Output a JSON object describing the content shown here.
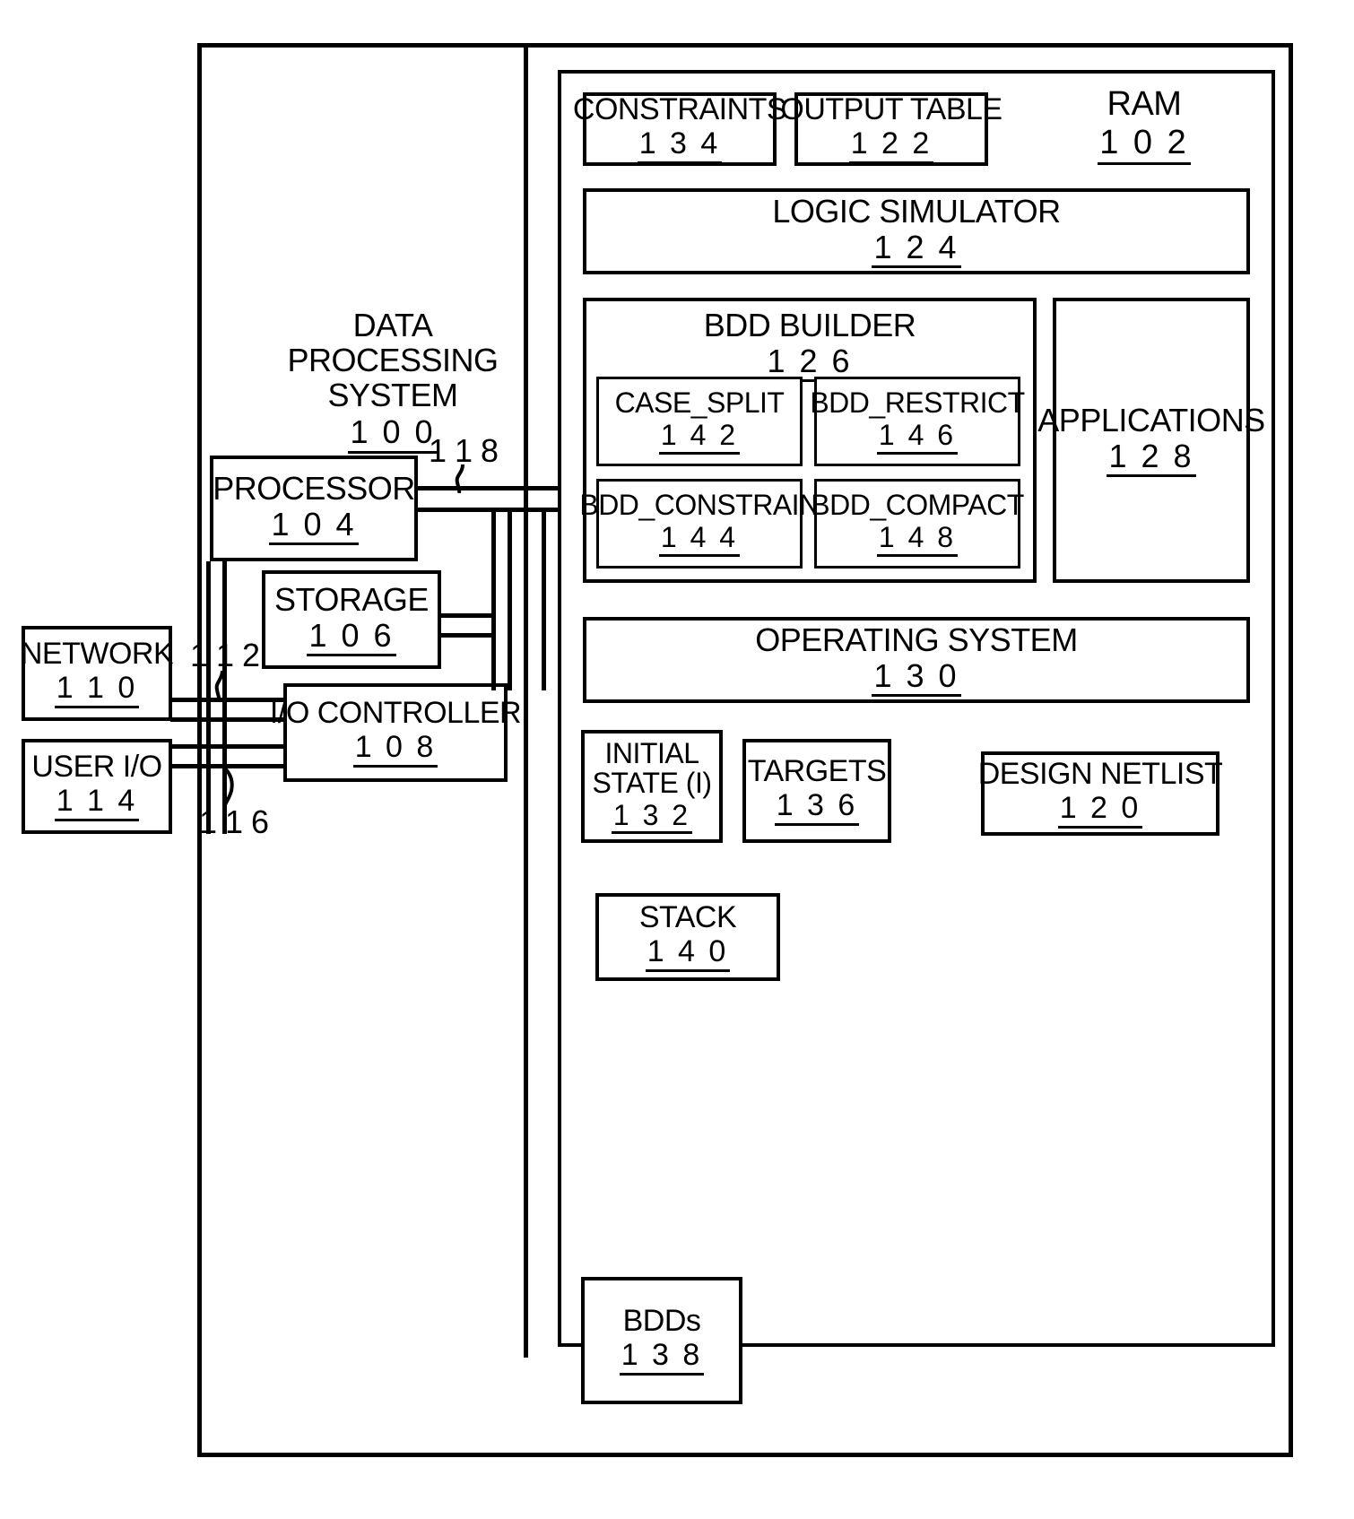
{
  "diagram": {
    "title_label": "DATA PROCESSING SYSTEM",
    "title_number": "1 0 0",
    "ram": {
      "label": "RAM",
      "number": "1 0 2"
    },
    "blocks": {
      "constraints": {
        "label": "CONSTRAINTS",
        "number": "1 3 4"
      },
      "output_table": {
        "label": "OUTPUT TABLE",
        "number": "1 2 2"
      },
      "logic_simulator": {
        "label": "LOGIC SIMULATOR",
        "number": "1 2 4"
      },
      "bdd_builder": {
        "label": "BDD BUILDER",
        "number": "1 2 6"
      },
      "case_split": {
        "label": "CASE_SPLIT",
        "number": "1 4 2"
      },
      "bdd_restrict": {
        "label": "BDD_RESTRICT",
        "number": "1 4 6"
      },
      "bdd_constrain": {
        "label": "BDD_CONSTRAIN",
        "number": "1 4 4"
      },
      "bdd_compact": {
        "label": "BDD_COMPACT",
        "number": "1 4 8"
      },
      "applications": {
        "label": "APPLICATIONS",
        "number": "1 2 8"
      },
      "operating_system": {
        "label": "OPERATING SYSTEM",
        "number": "1 3 0"
      },
      "initial_state": {
        "label_line1": "INITIAL",
        "label_line2": "STATE (I)",
        "number": "1 3 2"
      },
      "targets": {
        "label": "TARGETS",
        "number": "1 3 6"
      },
      "design_netlist": {
        "label": "DESIGN NETLIST",
        "number": "1 2 0"
      },
      "stack": {
        "label": "STACK",
        "number": "1 4 0"
      },
      "bdds": {
        "label": "BDDs",
        "number": "1 3 8"
      },
      "processor": {
        "label": "PROCESSOR",
        "number": "1 0 4"
      },
      "storage": {
        "label": "STORAGE",
        "number": "1 0 6"
      },
      "io_controller": {
        "label": "I/O CONTROLLER",
        "number": "1 0 8"
      },
      "network": {
        "label": "NETWORK",
        "number": "1 1 0"
      },
      "user_io": {
        "label": "USER I/O",
        "number": "1 1 4"
      }
    },
    "bus_labels": {
      "bus_118": "1 1 8",
      "bus_112": "1 1 2",
      "bus_116": "1 1 6"
    }
  }
}
